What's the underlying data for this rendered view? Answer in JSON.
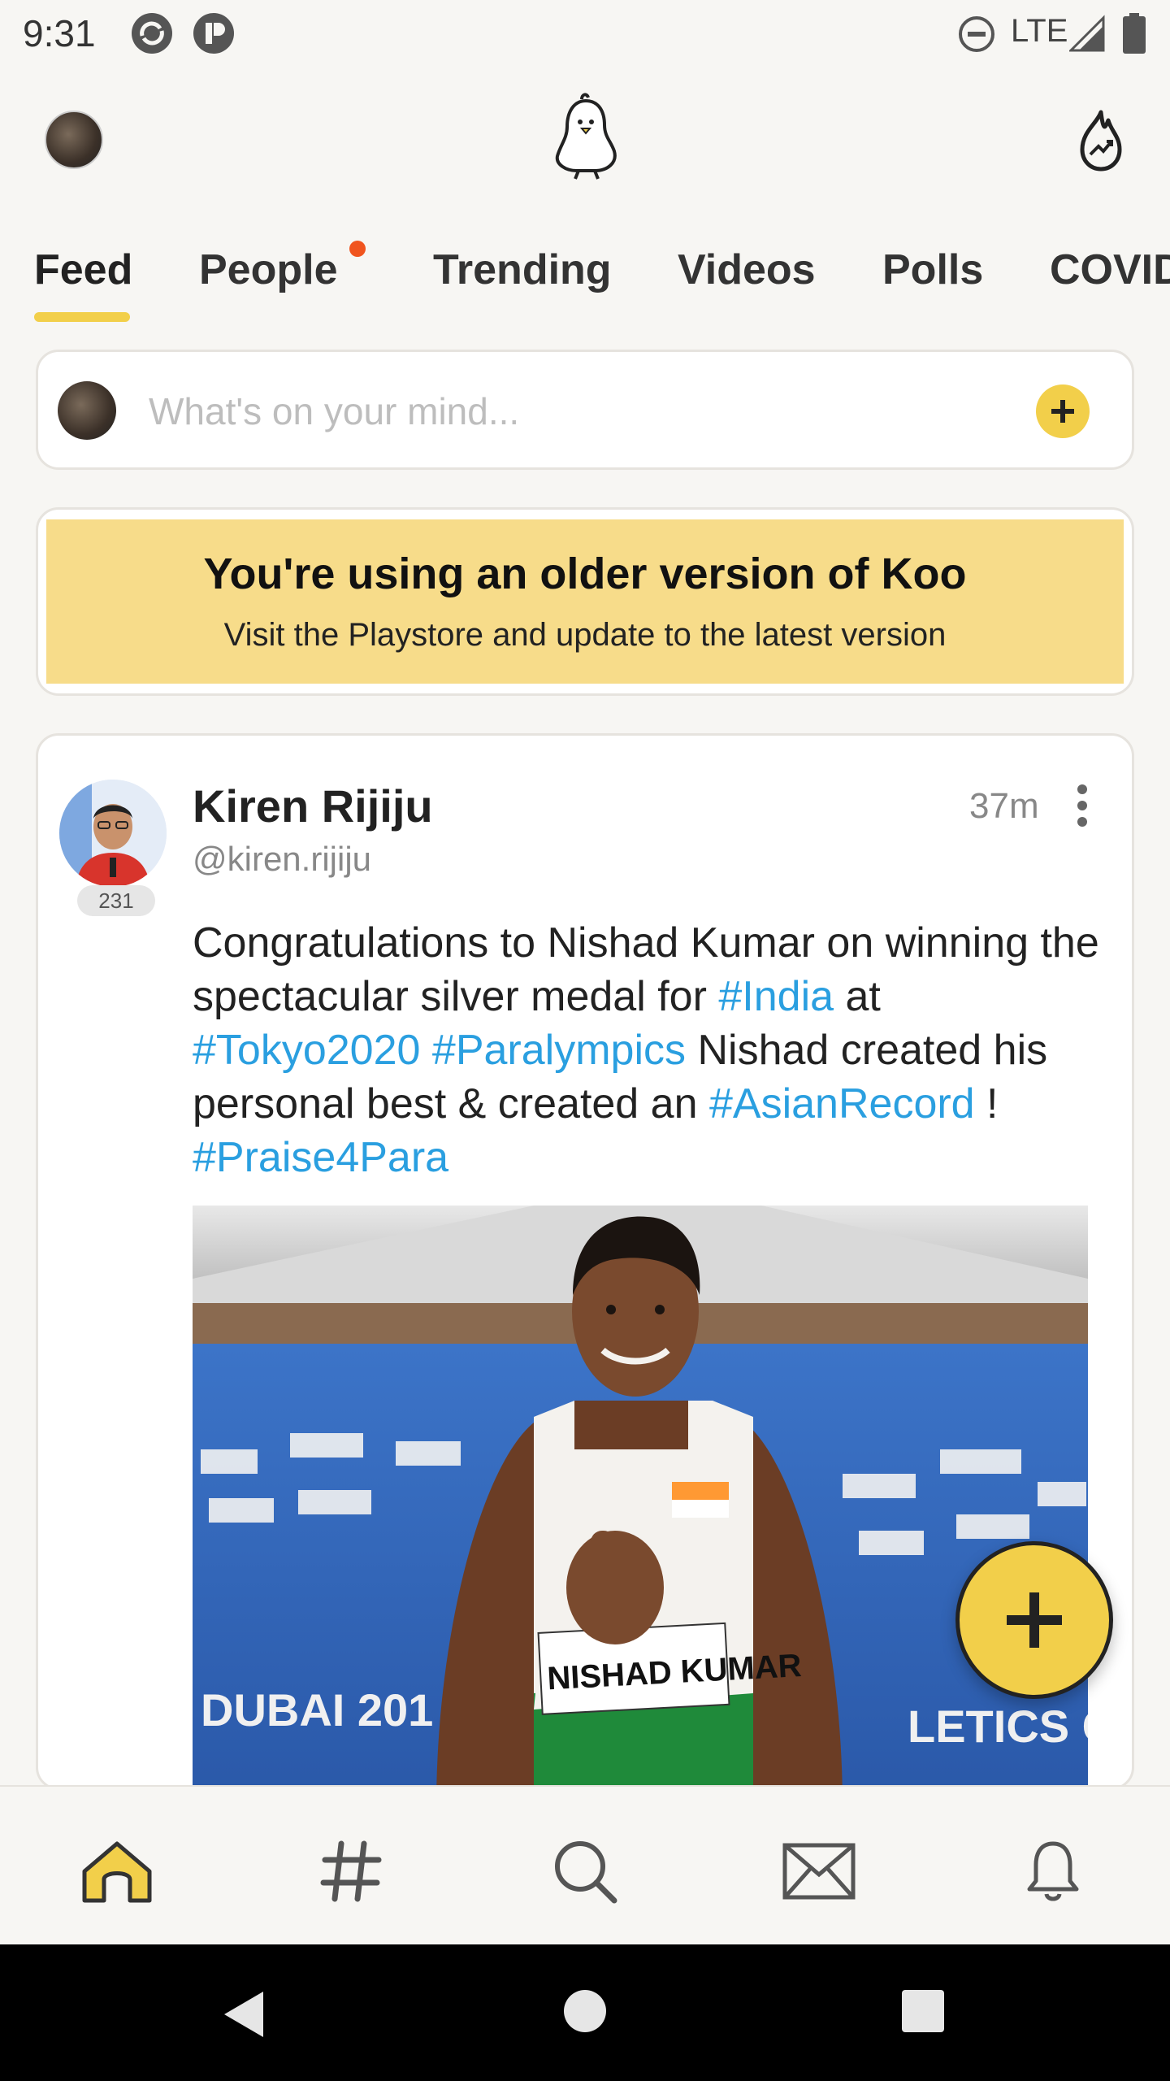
{
  "status_bar": {
    "time": "9:31",
    "network": "LTE"
  },
  "header": {
    "logo_icon": "koo-bird-icon",
    "trending_icon": "flame-trend-icon"
  },
  "tabs": [
    {
      "label": "Feed",
      "active": true
    },
    {
      "label": "People",
      "active": false,
      "has_dot": true
    },
    {
      "label": "Trending",
      "active": false
    },
    {
      "label": "Videos",
      "active": false
    },
    {
      "label": "Polls",
      "active": false
    },
    {
      "label": "COVID",
      "active": false
    }
  ],
  "composer": {
    "placeholder": "What's on your mind..."
  },
  "banner": {
    "title": "You're using an older version of Koo",
    "subtitle": "Visit the Playstore and update to the latest version"
  },
  "post": {
    "author_name": "Kiren Rijiju",
    "author_handle": "@kiren.rijiju",
    "badge_count": "231",
    "time": "37m",
    "text_parts": {
      "p1": "Congratulations to Nishad Kumar on winning the spectacular silver medal for ",
      "tag1": "#India",
      "p2": " at ",
      "tag2": "#Tokyo2020",
      "p3": " ",
      "tag3": "#Paralympics",
      "p4": " Nishad created his personal best & created an ",
      "tag4": "#AsianRecord",
      "p5": " ! ",
      "tag5": "#Praise4Para"
    },
    "image": {
      "backdrop_text": "DUBAI 201",
      "backdrop_text_right": "LETICS CH",
      "bib_text": "NISHAD KUMAR"
    }
  },
  "bottom_nav": [
    {
      "icon": "home-icon",
      "active": true
    },
    {
      "icon": "hashtag-icon",
      "active": false
    },
    {
      "icon": "search-icon",
      "active": false
    },
    {
      "icon": "mail-icon",
      "active": false
    },
    {
      "icon": "bell-icon",
      "active": false
    }
  ],
  "colors": {
    "accent": "#f2cf4a",
    "link": "#2a9fe0",
    "banner_bg": "#f7dc8a",
    "notification_dot": "#f0541e"
  }
}
